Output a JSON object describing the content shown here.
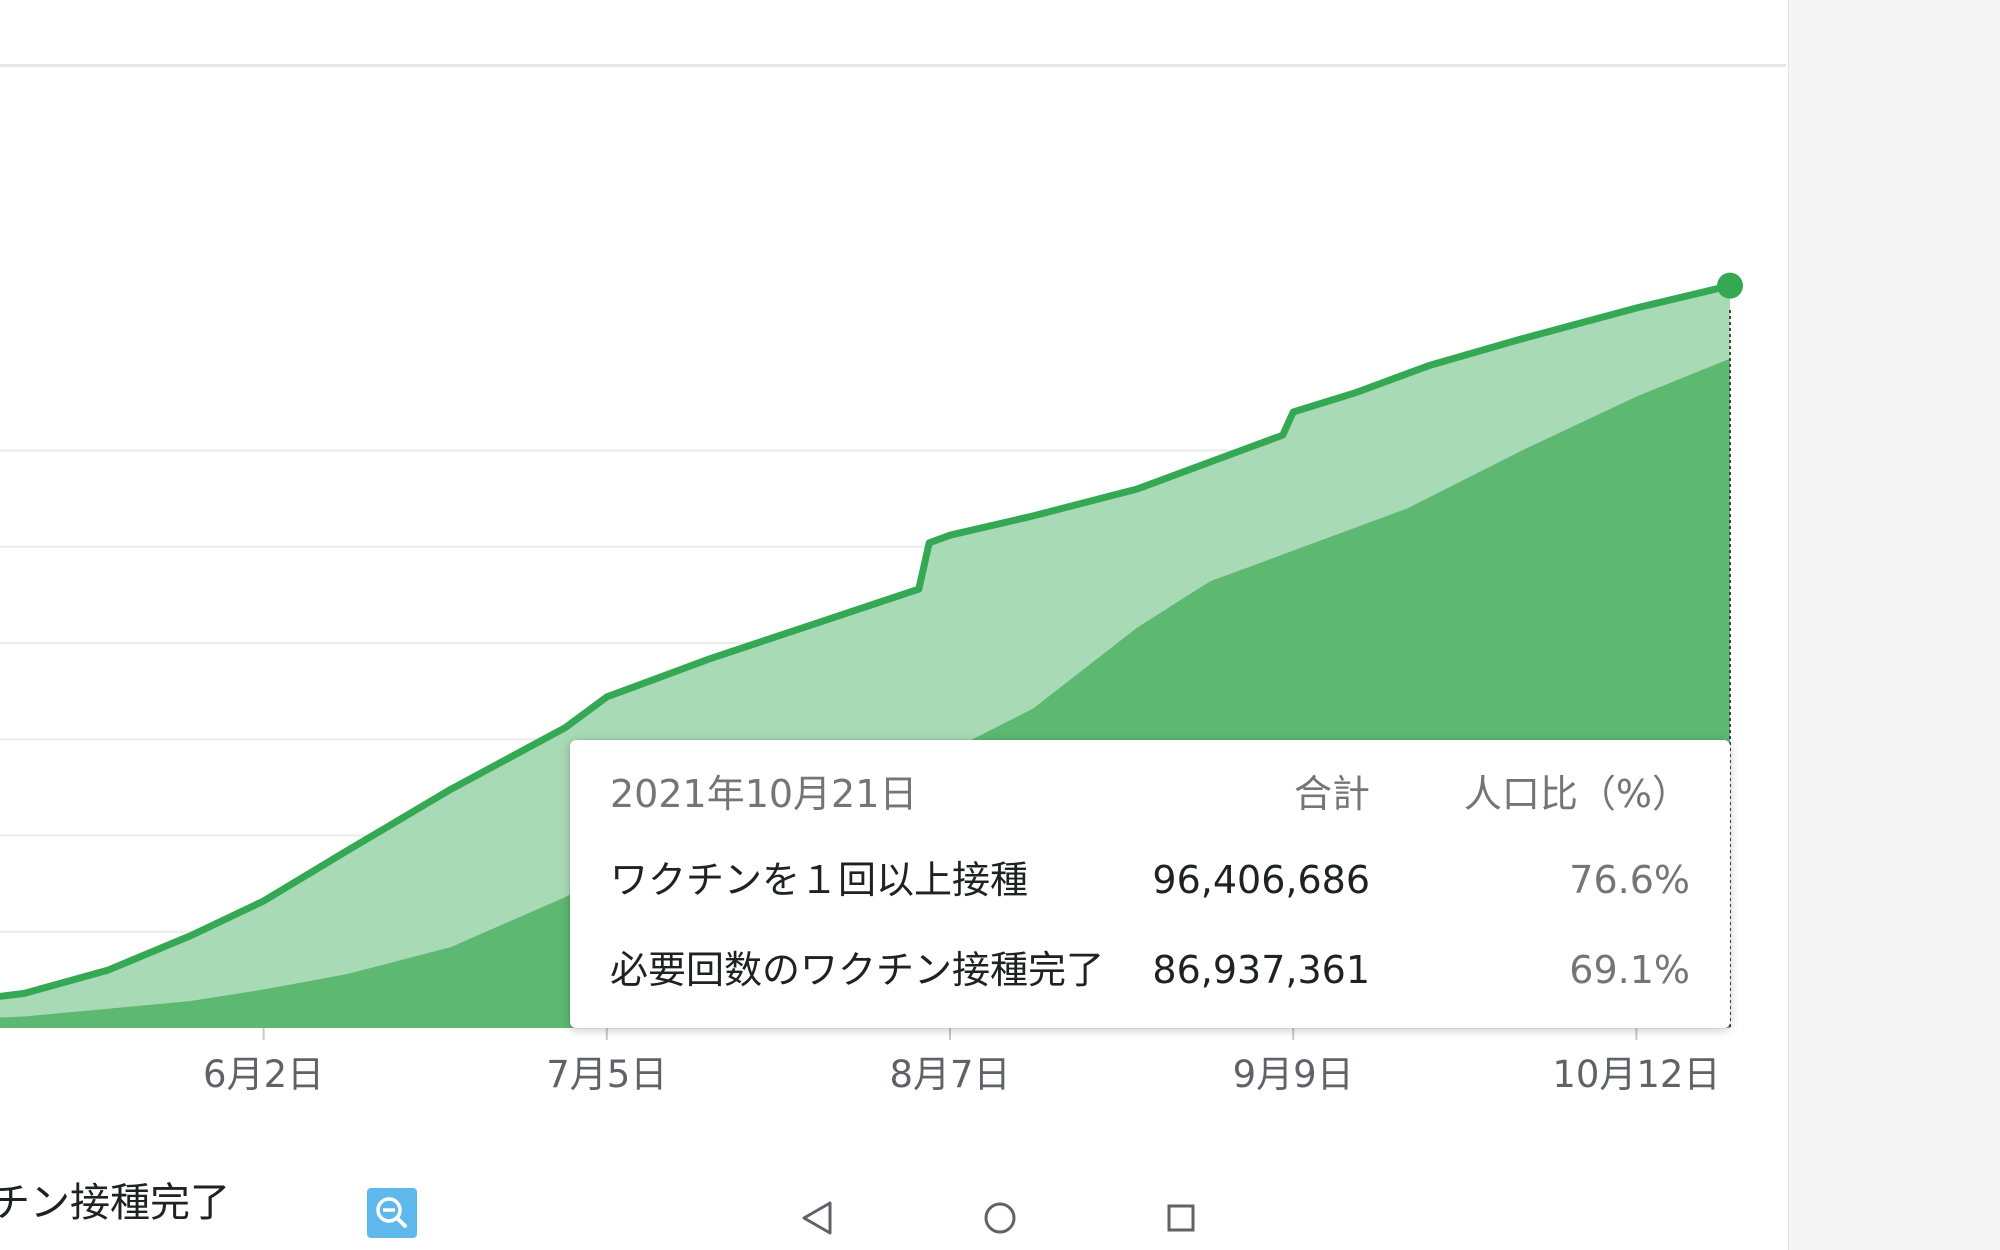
{
  "chart_data": {
    "type": "area",
    "x_ticks": [
      "6月2日",
      "7月5日",
      "8月7日",
      "9月9日",
      "10月12日"
    ],
    "xlim": [
      "2021-04-23",
      "2021-10-21"
    ],
    "ylim": [
      0,
      140000000
    ],
    "grid": true,
    "series": [
      {
        "name": "ワクチンを１回以上接種",
        "color": "#34a853",
        "fill": "#a8dab5",
        "points": [
          [
            "2021-04-23",
            1800000
          ],
          [
            "2021-05-01",
            3000000
          ],
          [
            "2021-05-10",
            4500000
          ],
          [
            "2021-05-18",
            7500000
          ],
          [
            "2021-05-26",
            12000000
          ],
          [
            "2021-06-02",
            16500000
          ],
          [
            "2021-06-10",
            23000000
          ],
          [
            "2021-06-20",
            31000000
          ],
          [
            "2021-07-01",
            39000000
          ],
          [
            "2021-07-05",
            43000000
          ],
          [
            "2021-07-15",
            48000000
          ],
          [
            "2021-07-25",
            52500000
          ],
          [
            "2021-08-04",
            57000000
          ],
          [
            "2021-08-05",
            63000000
          ],
          [
            "2021-08-07",
            64000000
          ],
          [
            "2021-08-15",
            66500000
          ],
          [
            "2021-08-25",
            70000000
          ],
          [
            "2021-09-01",
            73500000
          ],
          [
            "2021-09-08",
            77000000
          ],
          [
            "2021-09-09",
            80000000
          ],
          [
            "2021-09-15",
            82500000
          ],
          [
            "2021-09-22",
            86000000
          ],
          [
            "2021-10-01",
            89500000
          ],
          [
            "2021-10-12",
            93500000
          ],
          [
            "2021-10-21",
            96406686
          ]
        ]
      },
      {
        "name": "必要回数のワクチン接種完了",
        "color": "#5db872",
        "fill": "#5db872",
        "points": [
          [
            "2021-04-23",
            600000
          ],
          [
            "2021-05-10",
            1500000
          ],
          [
            "2021-05-26",
            3500000
          ],
          [
            "2021-06-02",
            5000000
          ],
          [
            "2021-06-10",
            7000000
          ],
          [
            "2021-06-20",
            10500000
          ],
          [
            "2021-07-01",
            17000000
          ],
          [
            "2021-07-05",
            20000000
          ],
          [
            "2021-07-15",
            25000000
          ],
          [
            "2021-07-25",
            29500000
          ],
          [
            "2021-08-04",
            34000000
          ],
          [
            "2021-08-07",
            36000000
          ],
          [
            "2021-08-15",
            41500000
          ],
          [
            "2021-08-25",
            52000000
          ],
          [
            "2021-09-01",
            58000000
          ],
          [
            "2021-09-09",
            62000000
          ],
          [
            "2021-09-20",
            67500000
          ],
          [
            "2021-10-01",
            75000000
          ],
          [
            "2021-10-12",
            82000000
          ],
          [
            "2021-10-21",
            86937361
          ]
        ]
      }
    ]
  },
  "tooltip": {
    "date": "2021年10月21日",
    "col_total": "合計",
    "col_ratio": "人口比（%）",
    "rows": [
      {
        "label": "ワクチンを１回以上接種",
        "total": "96,406,686",
        "ratio": "76.6%"
      },
      {
        "label": "必要回数のワクチン接種完了",
        "total": "86,937,361",
        "ratio": "69.1%"
      }
    ]
  },
  "legend": {
    "partial_label": "チン接種完了"
  },
  "colors": {
    "line": "#34a853",
    "area_light": "#a8dab5",
    "area_dark": "#5db872",
    "zoom_button": "#5fb8ec"
  },
  "icons": {
    "zoom_out": "zoom-out-icon",
    "back": "back-triangle-icon",
    "home": "home-circle-icon",
    "recents": "recents-square-icon"
  }
}
